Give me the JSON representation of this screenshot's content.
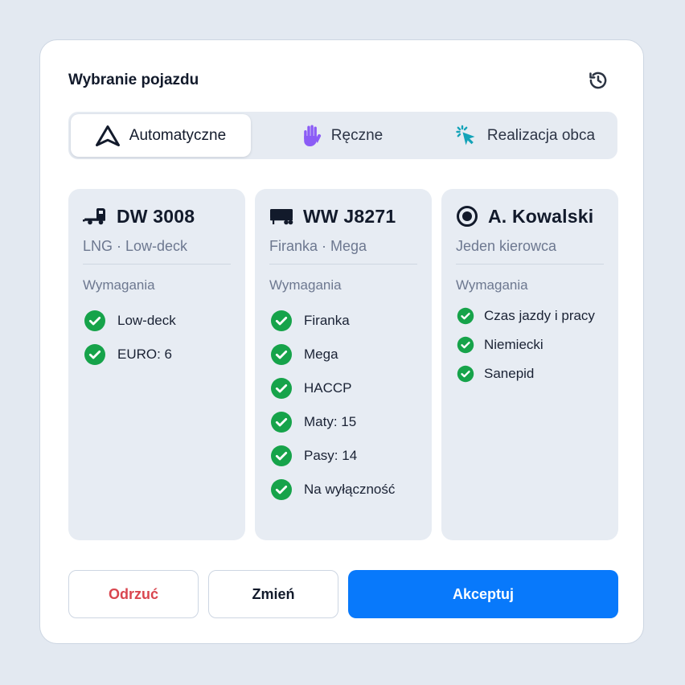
{
  "header": {
    "title": "Wybranie pojazdu",
    "history_icon": "history-icon"
  },
  "tabs": [
    {
      "label": "Automatyczne",
      "icon": "navigation-arrow-icon",
      "active": true
    },
    {
      "label": "Ręczne",
      "icon": "hand-icon",
      "active": false
    },
    {
      "label": "Realizacja obca",
      "icon": "cursor-click-icon",
      "active": false
    }
  ],
  "columns": [
    {
      "icon": "truck-tractor-icon",
      "title": "DW 3008",
      "subtitle": "LNG · Low-deck",
      "requirements_label": "Wymagania",
      "requirements": [
        "Low-deck",
        "EURO: 6"
      ]
    },
    {
      "icon": "trailer-icon",
      "title": "WW J8271",
      "subtitle": "Firanka · Mega",
      "requirements_label": "Wymagania",
      "requirements": [
        "Firanka",
        "Mega",
        "HACCP",
        "Maty: 15",
        "Pasy: 14",
        "Na wyłączność"
      ]
    },
    {
      "icon": "driver-radio-icon",
      "title": "A. Kowalski",
      "subtitle": "Jeden kierowca",
      "requirements_label": "Wymagania",
      "requirements": [
        "Czas jazdy i pracy",
        "Niemiecki",
        "Sanepid"
      ]
    }
  ],
  "actions": {
    "reject": "Odrzuć",
    "change": "Zmień",
    "accept": "Akceptuj"
  },
  "colors": {
    "accent": "#0879fb",
    "reject": "#d9464f",
    "check": "#16a34a",
    "hand": "#8b5cf6",
    "external": "#14a3b8"
  }
}
